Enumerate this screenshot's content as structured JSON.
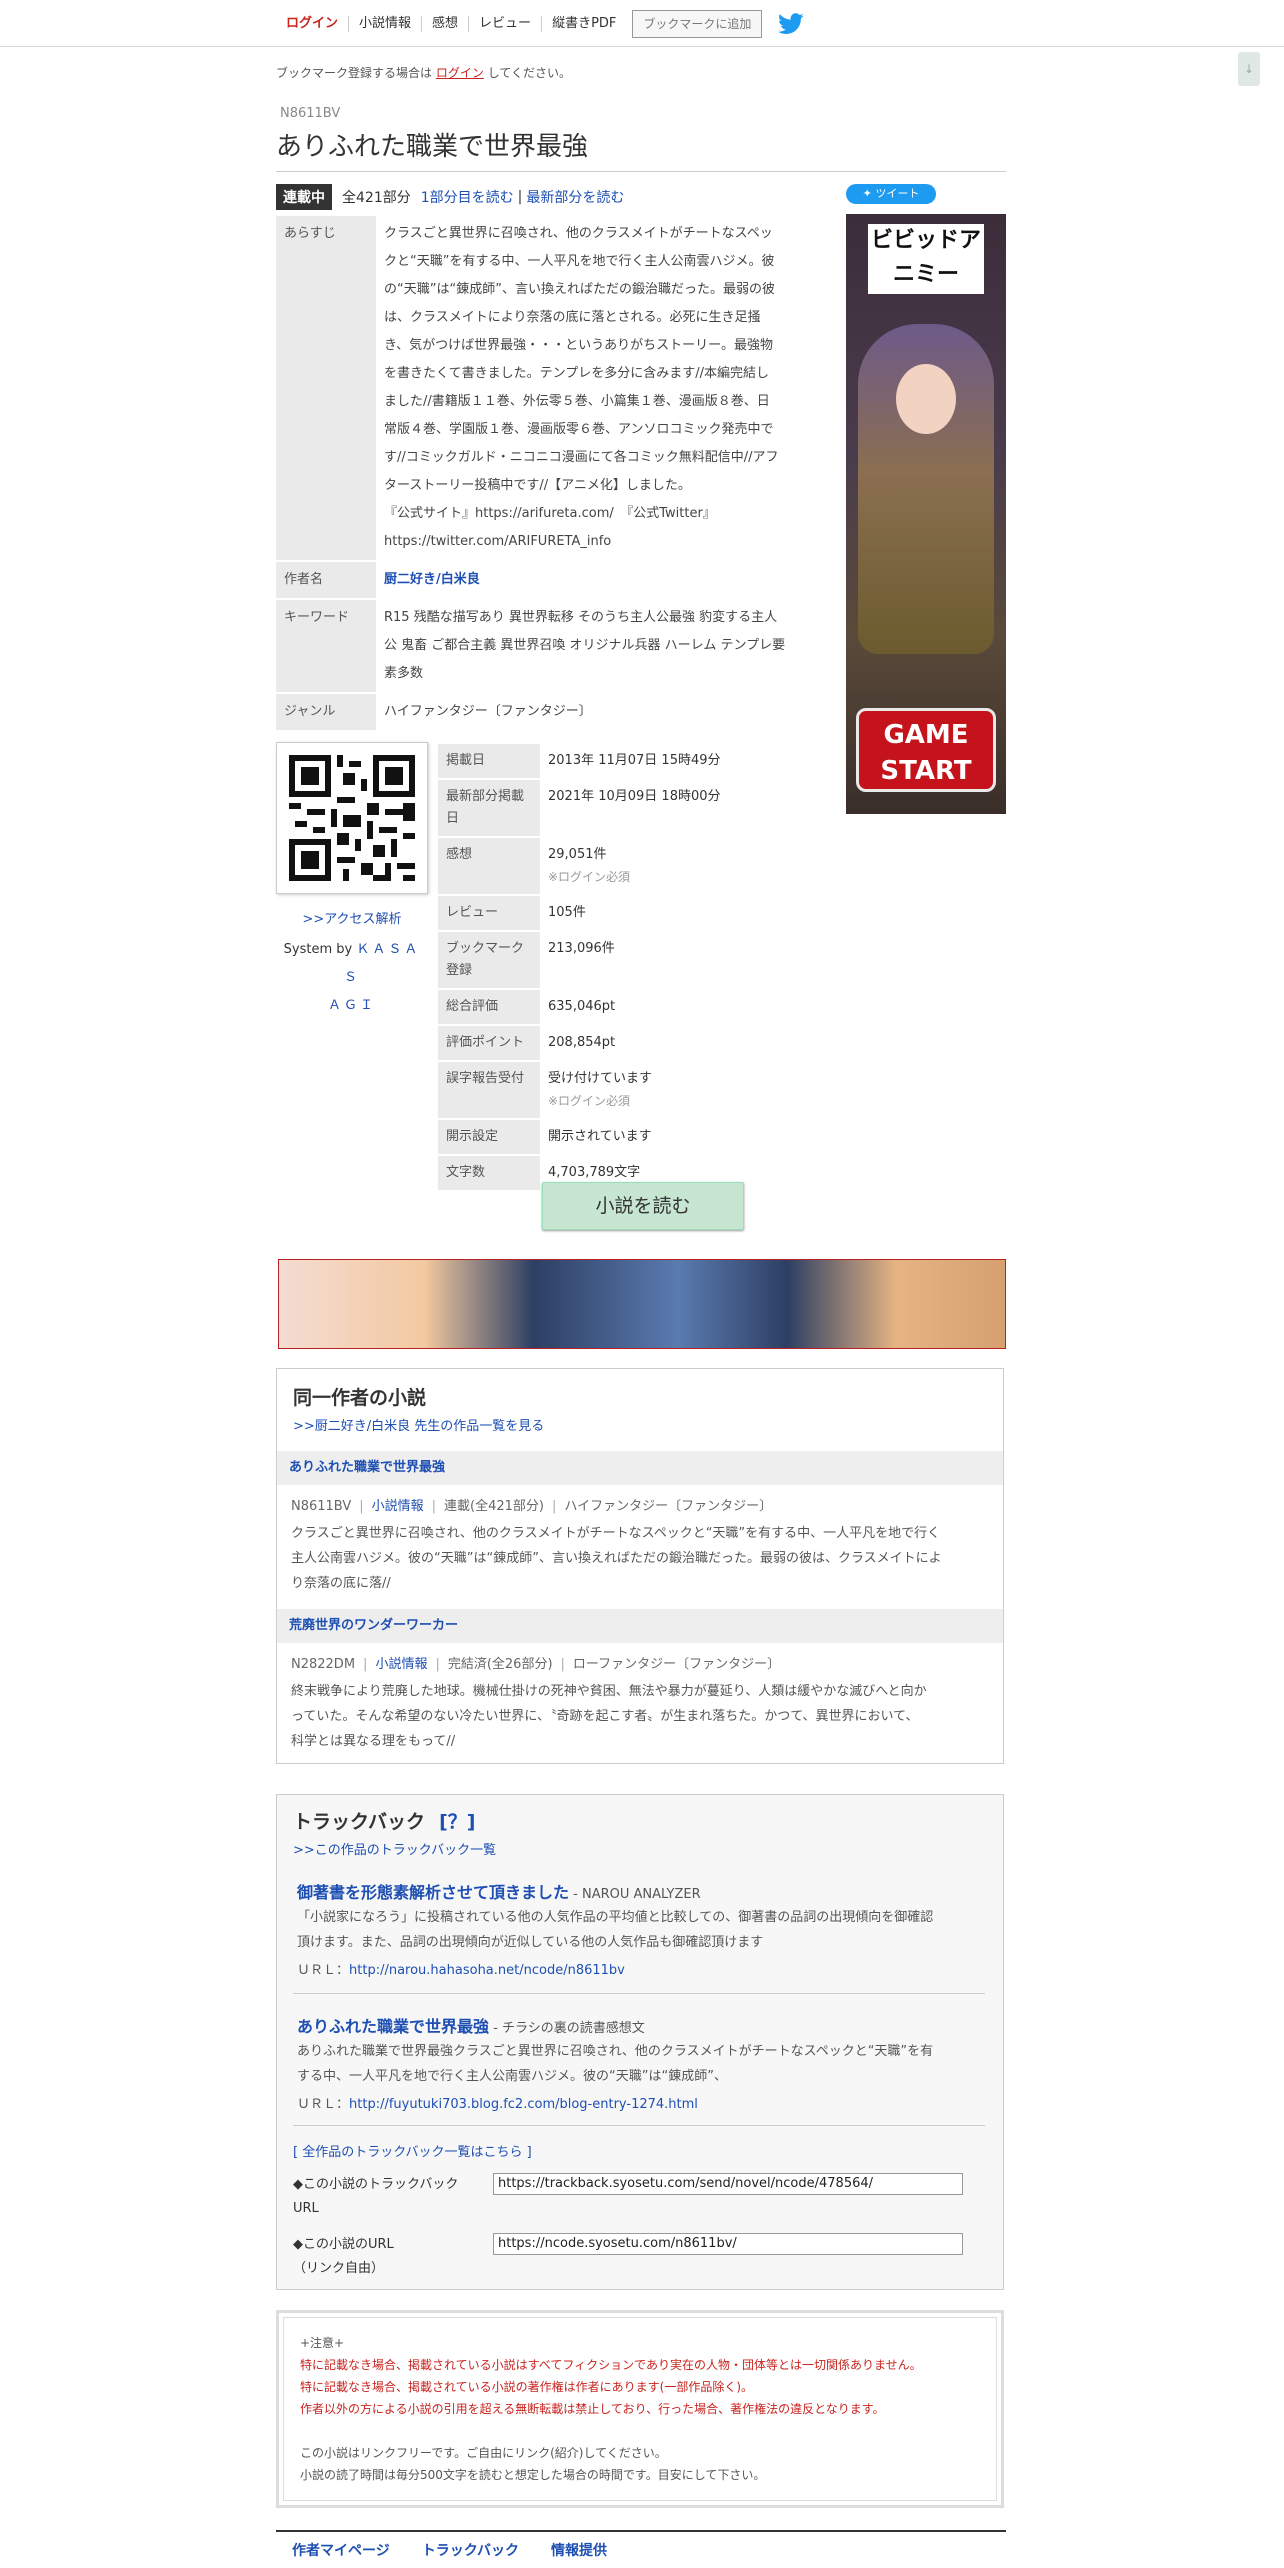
{
  "nav": {
    "login": "ログイン",
    "novel_info": "小説情報",
    "impressions": "感想",
    "review": "レビュー",
    "vertical_pdf": "縦書きPDF",
    "bookmark_add": "ブックマークに追加"
  },
  "scroll_button": "↓",
  "notice": {
    "prefix": "ブックマーク登録する場合は",
    "login_link": "ログイン",
    "suffix": "してください。"
  },
  "novel": {
    "ncode": "N8611BV",
    "title": "ありふれた職業で世界最強",
    "status_badge": "連載中",
    "episode_count": "全421部分",
    "read_first": "1部分目を読む",
    "read_latest": "最新部分を読む",
    "tweet": "ツイート"
  },
  "info_table": {
    "synopsis_label": "あらすじ",
    "synopsis_lines": [
      "クラスごと異世界に召喚され、他のクラスメイトがチートなスペッ",
      "クと“天職”を有する中、一人平凡を地で行く主人公南雲ハジメ。彼",
      "の“天職”は“錬成師”、言い換えればただの鍛治職だった。最弱の彼",
      "は、クラスメイトにより奈落の底に落とされる。必死に生き足掻",
      "き、気がつけば世界最強・・・というありがちストーリー。最強物",
      "を書きたくて書きました。テンプレを多分に含みます//本編完結し",
      "ました//書籍版１１巻、外伝零５巻、小篇集１巻、漫画版８巻、日",
      "常版４巻、学園版１巻、漫画版零６巻、アンソロコミック発売中で",
      "す//コミックガルド・ニコニコ漫画にて各コミック無料配信中//アフ",
      "ターストーリー投稿中です//【アニメ化】しました。",
      "『公式サイト』https://arifureta.com/　『公式Twitter』",
      "https://twitter.com/ARIFURETA_info"
    ],
    "author_label": "作者名",
    "author": "厨二好き/白米良",
    "keyword_label": "キーワード",
    "keywords_lines": [
      "R15 残酷な描写あり 異世界転移 そのうち主人公最強 豹変する主人",
      "公 鬼畜 ご都合主義 異世界召喚 オリジナル兵器 ハーレム テンプレ要",
      "素多数"
    ],
    "genre_label": "ジャンル",
    "genre": "ハイファンタジー〔ファンタジー〕"
  },
  "access": {
    "analysis_link": ">>アクセス解析",
    "system_by": "System by",
    "kasasagi_1": "ＫＡＳＡＳ",
    "kasasagi_2": "ＡＧＩ"
  },
  "stats": {
    "published_label": "掲載日",
    "published": "2013年 11月07日 15時49分",
    "latest_label": "最新部分掲載日",
    "latest": "2021年 10月09日 18時00分",
    "impressions_label": "感想",
    "impressions": "29,051件",
    "impressions_note": "※ログイン必須",
    "review_label": "レビュー",
    "review": "105件",
    "bookmark_label": "ブックマーク登録",
    "bookmark": "213,096件",
    "total_label": "総合評価",
    "total": "635,046pt",
    "points_label": "評価ポイント",
    "points": "208,854pt",
    "typo_label": "誤字報告受付",
    "typo": "受け付けています",
    "typo_note": "※ログイン必須",
    "disclosure_label": "開示設定",
    "disclosure": "開示されています",
    "chars_label": "文字数",
    "chars": "4,703,789文字"
  },
  "read_button": "小説を読む",
  "ad": {
    "logo": "ビビッドアニミー",
    "game_start_1": "GAME",
    "game_start_2": "START"
  },
  "same_author": {
    "heading": "同一作者の小説",
    "list_link": ">>厨二好き/白米良 先生の作品一覧を見る",
    "novels": [
      {
        "title": "ありふれた職業で世界最強",
        "ncode": "N8611BV",
        "info_link": "小説情報",
        "status": "連載(全421部分)",
        "genre": "ハイファンタジー〔ファンタジー〕",
        "desc_lines": [
          "クラスごと異世界に召喚され、他のクラスメイトがチートなスペックと“天職”を有する中、一人平凡を地で行く",
          "主人公南雲ハジメ。彼の“天職”は“錬成師”、言い換えればただの鍛治職だった。最弱の彼は、クラスメイトによ",
          "り奈落の底に落//"
        ]
      },
      {
        "title": "荒廃世界のワンダーワーカー",
        "ncode": "N2822DM",
        "info_link": "小説情報",
        "status": "完結済(全26部分)",
        "genre": "ローファンタジー〔ファンタジー〕",
        "desc_lines": [
          "終末戦争により荒廃した地球。機械仕掛けの死神や貧困、無法や暴力が蔓延り、人類は緩やかな滅びへと向か",
          "っていた。そんな希望のない冷たい世界に、〝奇跡を起こす者〟が生まれ落ちた。かつて、異世界において、",
          "科学とは異なる理をもって//"
        ]
      }
    ]
  },
  "trackback": {
    "heading": "トラックバック",
    "help": "[？]",
    "list_link": ">>この作品のトラックバック一覧",
    "entries": [
      {
        "title": "御著書を形態素解析させて頂きました",
        "source": " - NAROU ANALYZER",
        "desc_lines": [
          "「小説家になろう」に投稿されている他の人気作品の平均値と比較しての、御著書の品詞の出現傾向を御確認",
          "頂けます。また、品詞の出現傾向が近似している他の人気作品も御確認頂けます"
        ],
        "url_label": "ＵＲＬ：",
        "url": "http://narou.hahasoha.net/ncode/n8611bv"
      },
      {
        "title": "ありふれた職業で世界最強",
        "source": " - チラシの裏の読書感想文",
        "desc_lines": [
          "ありふれた職業で世界最強クラスごと異世界に召喚され、他のクラスメイトがチートなスペックと“天職”を有",
          "する中、一人平凡を地で行く主人公南雲ハジメ。彼の“天職”は“錬成師”、"
        ],
        "url_label": "ＵＲＬ：",
        "url": "http://fuyutuki703.blog.fc2.com/blog-entry-1274.html"
      }
    ],
    "all_link": "[ 全作品のトラックバック一覧はこちら ]",
    "tb_url_label_1": "◆この小説のトラックバック",
    "tb_url_label_2": "URL",
    "tb_url": "https://trackback.syosetu.com/send/novel/ncode/478564/",
    "novel_url_label_1": "◆この小説のURL",
    "novel_url_label_2": "（リンク自由）",
    "novel_url": "https://ncode.syosetu.com/n8611bv/"
  },
  "caution": {
    "heading": "+注意+",
    "red_lines": [
      "特に記載なき場合、掲載されている小説はすべてフィクションであり実在の人物・団体等とは一切関係ありません。",
      "特に記載なき場合、掲載されている小説の著作権は作者にあります(一部作品除く)。",
      "作者以外の方による小説の引用を超える無断転載は禁止しており、行った場合、著作権法の違反となります。"
    ],
    "gray_lines": [
      "この小説はリンクフリーです。ご自由にリンク(紹介)してください。",
      "小説の読了時間は毎分500文字を読むと想定した場合の時間です。目安にして下さい。"
    ]
  },
  "footer": {
    "mypage": "作者マイページ",
    "trackback": "トラックバック",
    "report": "情報提供"
  }
}
